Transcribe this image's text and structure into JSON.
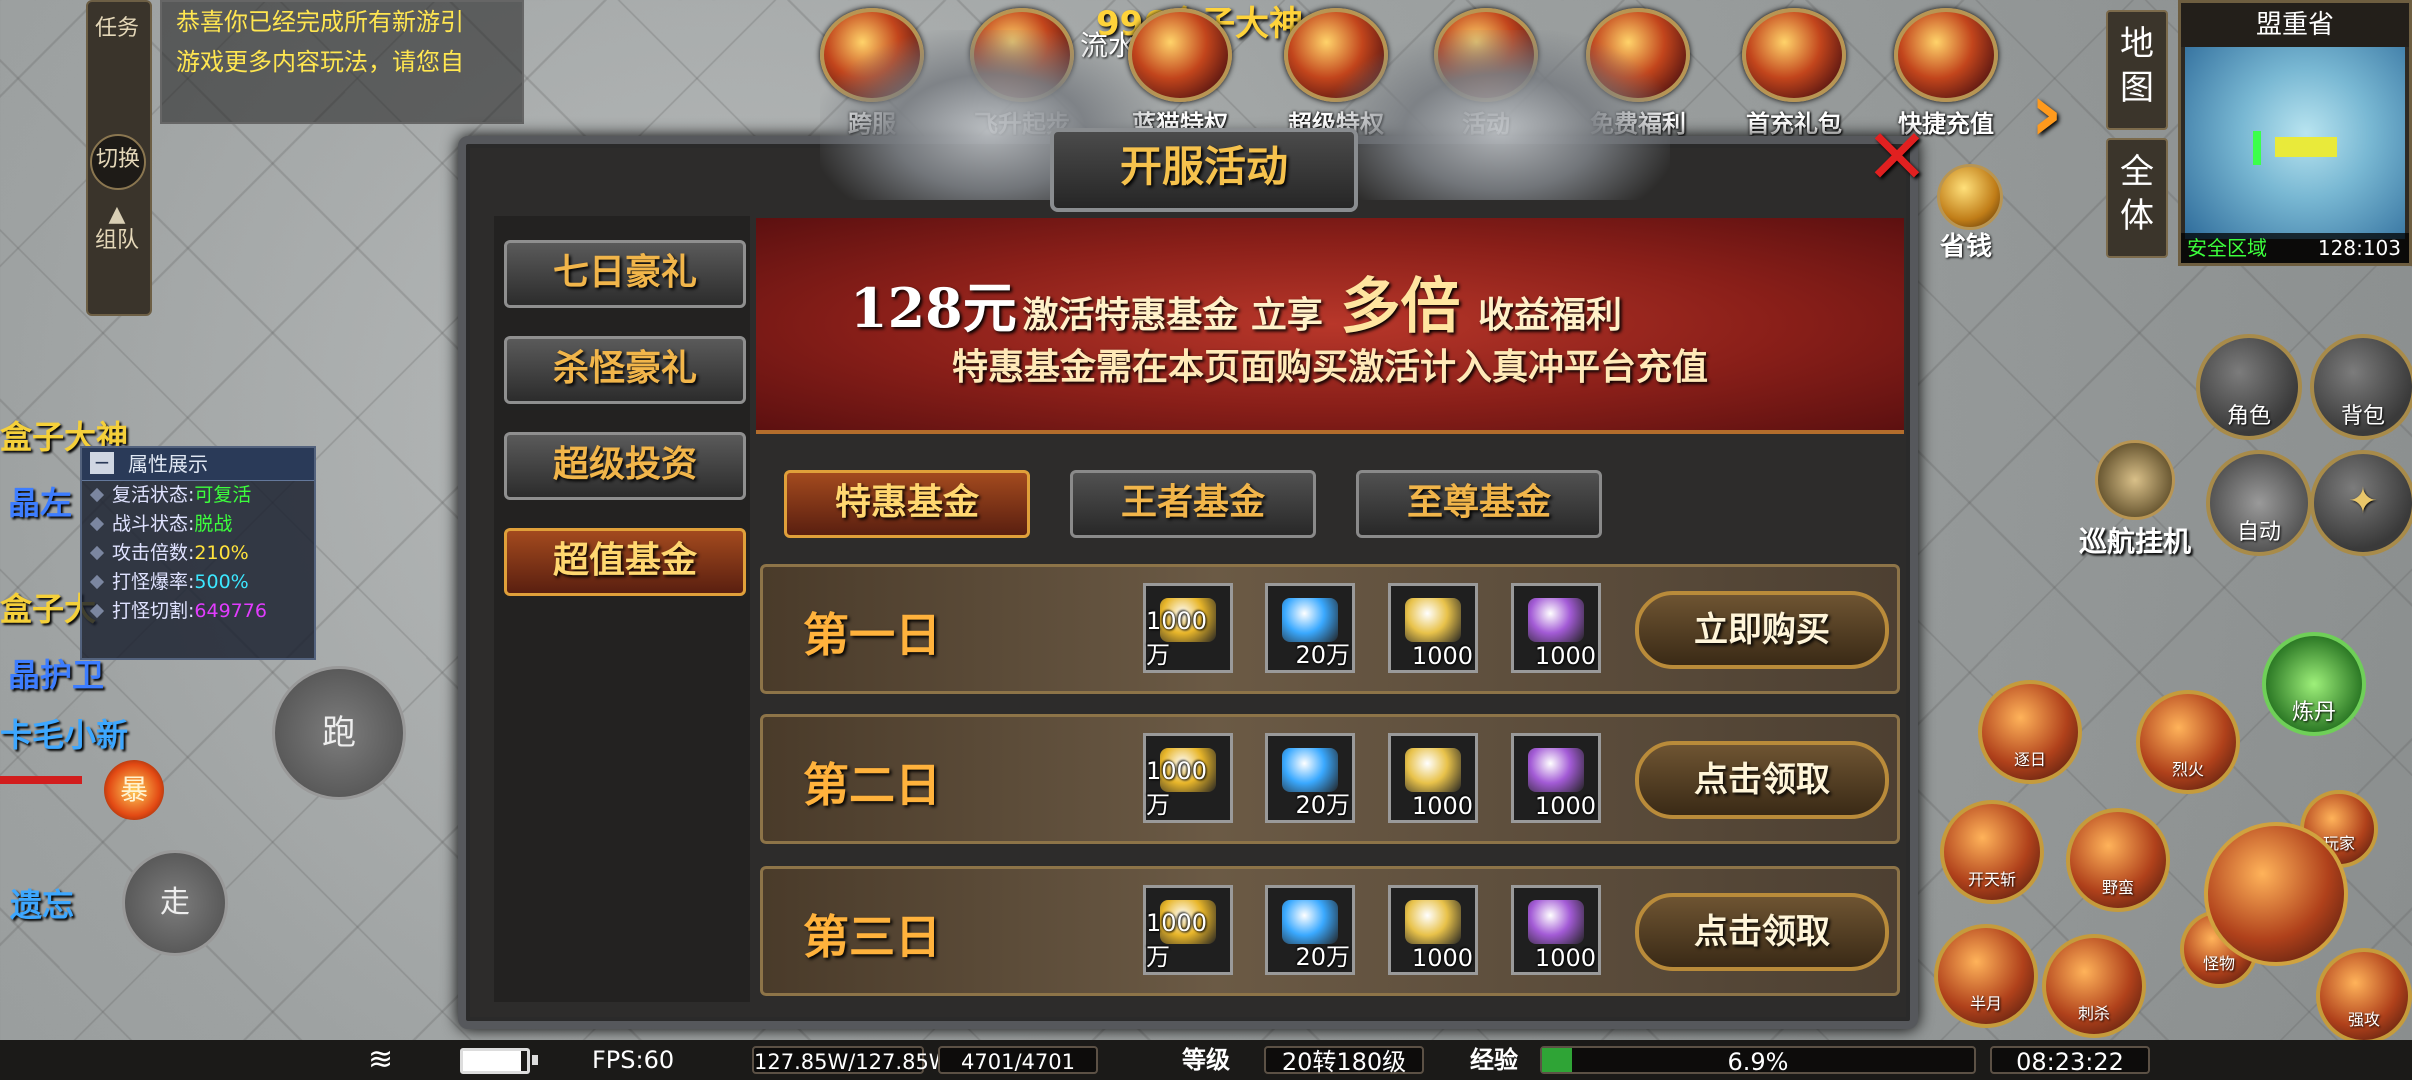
{
  "task_panel": {
    "task_label": "任务",
    "switch_label": "切换",
    "team_label": "组队"
  },
  "task_message": {
    "line1": "恭喜你已经完成所有新游引",
    "line2": "游戏更多内容玩法，请您自"
  },
  "left_names": [
    {
      "text": "盒子大神",
      "color": "#f5d03a"
    },
    {
      "text": "晶左",
      "color": "#3d7dff"
    },
    {
      "text": "盒子大",
      "color": "#f5d03a"
    },
    {
      "text": "晶护卫",
      "color": "#3d7dff"
    },
    {
      "text": "卡毛小新",
      "color": "#3da7ff"
    },
    {
      "text": "遗忘",
      "color": "#3da7ff"
    }
  ],
  "attr_panel": {
    "title": "属性展示",
    "rows": [
      {
        "label": "复活状态:",
        "value": "可复活",
        "color": "#3cff3c"
      },
      {
        "label": "战斗状态:",
        "value": "脱战",
        "color": "#3cff3c"
      },
      {
        "label": "攻击倍数:",
        "value": "210%",
        "color": "#ffe23c"
      },
      {
        "label": "打怪爆率:",
        "value": "500%",
        "color": "#3ce7ff"
      },
      {
        "label": "打怪切割:",
        "value": "649776",
        "color": "#e23cff"
      }
    ]
  },
  "joystick": {
    "run": "跑",
    "explode": "暴",
    "walk": "走"
  },
  "top_bar": {
    "top_name": "996盒子大神",
    "player_tag": "流水",
    "icons": [
      {
        "label": "跨服",
        "icon": "cross-server-icon"
      },
      {
        "label": "飞升起步",
        "icon": "ascend-icon"
      },
      {
        "label": "蓝猫特权",
        "icon": "privilege-icon"
      },
      {
        "label": "超级特权",
        "icon": "super-privilege-icon"
      },
      {
        "label": "活动",
        "icon": "event-icon"
      },
      {
        "label": "免费福利",
        "icon": "free-welfare-icon"
      },
      {
        "label": "首充礼包",
        "icon": "first-charge-icon"
      },
      {
        "label": "快捷充值",
        "icon": "quick-recharge-icon"
      }
    ],
    "saving_label": "省钱"
  },
  "right_nav": {
    "map": "地图",
    "all": "全体"
  },
  "minimap": {
    "title": "盟重省",
    "zone": "安全区域",
    "coords": "128:103"
  },
  "right_buttons": {
    "character": "角色",
    "bag": "背包",
    "cruise": "巡航挂机",
    "auto": "自动",
    "skill_stone": "炼丹"
  },
  "skills": [
    {
      "label": "逐日"
    },
    {
      "label": "烈火"
    },
    {
      "label": "开天斩"
    },
    {
      "label": "野蛮"
    },
    {
      "label": "半月"
    },
    {
      "label": "刺杀"
    },
    {
      "label": "强攻"
    },
    {
      "label": "玩家"
    },
    {
      "label": "怪物"
    }
  ],
  "dialog": {
    "title": "开服活动",
    "side_menu": [
      {
        "label": "七日豪礼",
        "active": false
      },
      {
        "label": "杀怪豪礼",
        "active": false
      },
      {
        "label": "超级投资",
        "active": false
      },
      {
        "label": "超值基金",
        "active": true
      }
    ],
    "banner": {
      "price": "128元",
      "activate": "激活特惠基金 立享",
      "multiplier": "多倍",
      "benefit": "收益福利",
      "note": "特惠基金需在本页面购买激活计入真冲平台充值"
    },
    "fund_tabs": [
      {
        "label": "特惠基金",
        "active": true
      },
      {
        "label": "王者基金",
        "active": false
      },
      {
        "label": "至尊基金",
        "active": false
      }
    ],
    "days": [
      {
        "label": "第一日",
        "button": "立即购买",
        "items": [
          {
            "name": "gold-ingot-icon",
            "qty": "1000万",
            "color": "#e8b62a"
          },
          {
            "name": "diamond-icon",
            "qty": "20万",
            "color": "#3aa9ff"
          },
          {
            "name": "scroll-icon",
            "qty": "1000",
            "color": "#e8c24a"
          },
          {
            "name": "purple-gem-icon",
            "qty": "1000",
            "color": "#a35bd6"
          }
        ]
      },
      {
        "label": "第二日",
        "button": "点击领取",
        "items": [
          {
            "name": "gold-ingot-icon",
            "qty": "1000万",
            "color": "#e8b62a"
          },
          {
            "name": "diamond-icon",
            "qty": "20万",
            "color": "#3aa9ff"
          },
          {
            "name": "scroll-icon",
            "qty": "1000",
            "color": "#e8c24a"
          },
          {
            "name": "purple-gem-icon",
            "qty": "1000",
            "color": "#a35bd6"
          }
        ]
      },
      {
        "label": "第三日",
        "button": "点击领取",
        "items": [
          {
            "name": "gold-ingot-icon",
            "qty": "1000万",
            "color": "#e8b62a"
          },
          {
            "name": "diamond-icon",
            "qty": "20万",
            "color": "#3aa9ff"
          },
          {
            "name": "scroll-icon",
            "qty": "1000",
            "color": "#e8c24a"
          },
          {
            "name": "purple-gem-icon",
            "qty": "1000",
            "color": "#a35bd6"
          }
        ]
      }
    ]
  },
  "status_bar": {
    "fps": "FPS:60",
    "hp": "127.85W/127.85W",
    "mp": "4701/4701",
    "level_label": "等级",
    "level": "20转180级",
    "exp_label": "经验",
    "exp_percent": "6.9%",
    "exp_fraction": 0.069,
    "time": "08:23:22",
    "battery_level": 0.9
  }
}
